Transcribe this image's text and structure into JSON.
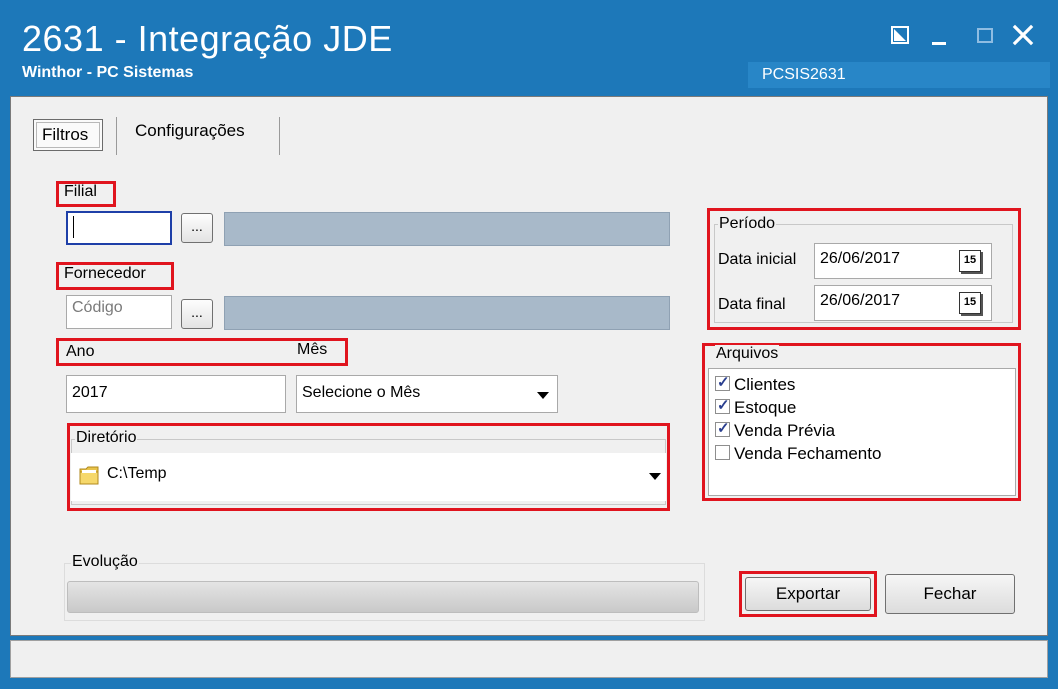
{
  "window": {
    "title": "2631 - Integração JDE",
    "subtitle": "Winthor - PC Sistemas",
    "program_code": "PCSIS2631"
  },
  "tabs": [
    {
      "label": "Filtros",
      "selected": true
    },
    {
      "label": "Configurações",
      "selected": false
    }
  ],
  "filial": {
    "label": "Filial",
    "value": "",
    "button_label": "...",
    "description": ""
  },
  "fornecedor": {
    "label": "Fornecedor",
    "placeholder": "Código",
    "button_label": "...",
    "description": ""
  },
  "ano": {
    "label": "Ano",
    "value": "2017"
  },
  "mes": {
    "label": "Mês",
    "selected": "Selecione o Mês"
  },
  "diretorio": {
    "label": "Diretório",
    "value": "C:\\Temp"
  },
  "periodo": {
    "label": "Período",
    "data_inicial_label": "Data inicial",
    "data_inicial": "26/06/2017",
    "data_final_label": "Data final",
    "data_final": "26/06/2017",
    "calendar_icon_text": "15"
  },
  "arquivos": {
    "label": "Arquivos",
    "items": [
      {
        "label": "Clientes",
        "checked": true
      },
      {
        "label": "Estoque",
        "checked": true
      },
      {
        "label": "Venda Prévia",
        "checked": true
      },
      {
        "label": "Venda Fechamento",
        "checked": false
      }
    ]
  },
  "evolucao": {
    "label": "Evolução",
    "progress": 0
  },
  "buttons": {
    "exportar": "Exportar",
    "fechar": "Fechar"
  },
  "colors": {
    "titlebar": "#1d78b9",
    "highlight": "#e0141e",
    "focus_border": "#1e3fa8",
    "disabled_field": "#a8b9c9"
  }
}
